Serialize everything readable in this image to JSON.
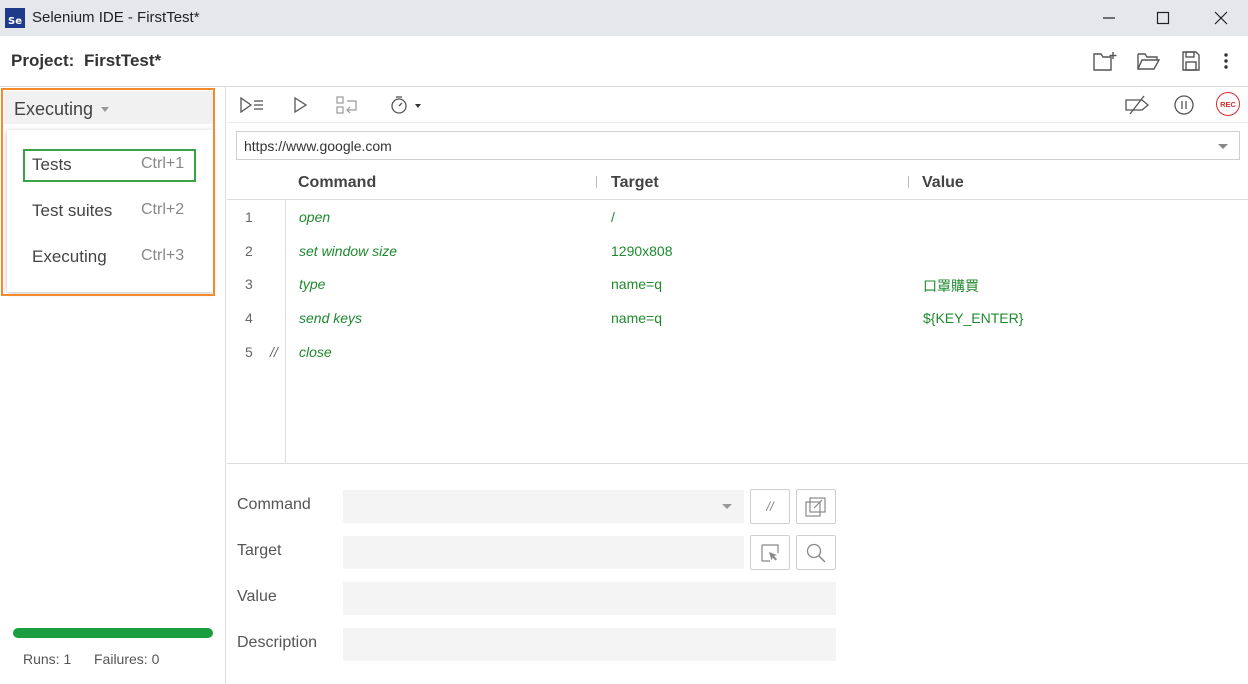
{
  "window": {
    "logo_text": "Se",
    "title": "Selenium IDE - FirstTest*"
  },
  "project": {
    "label": "Project:",
    "name": "FirstTest*"
  },
  "sidebar": {
    "current_view": "Executing",
    "menu": [
      {
        "label": "Tests",
        "shortcut": "Ctrl+1"
      },
      {
        "label": "Test suites",
        "shortcut": "Ctrl+2"
      },
      {
        "label": "Executing",
        "shortcut": "Ctrl+3"
      }
    ],
    "progress": 1.0,
    "runs": "Runs: 1",
    "failures": "Failures: 0"
  },
  "toolbar": {
    "rec_label": "REC"
  },
  "url": {
    "value": "https://www.google.com"
  },
  "table": {
    "headers": {
      "command": "Command",
      "target": "Target",
      "value": "Value"
    },
    "rows": [
      {
        "num": "1",
        "comment": "",
        "command": "open",
        "target": "/",
        "value": ""
      },
      {
        "num": "2",
        "comment": "",
        "command": "set window size",
        "target": "1290x808",
        "value": ""
      },
      {
        "num": "3",
        "comment": "",
        "command": "type",
        "target": "name=q",
        "value": "口罩購買"
      },
      {
        "num": "4",
        "comment": "",
        "command": "send keys",
        "target": "name=q",
        "value": "${KEY_ENTER}"
      },
      {
        "num": "5",
        "comment": "//",
        "command": "close",
        "target": "",
        "value": ""
      }
    ]
  },
  "editor": {
    "command_label": "Command",
    "target_label": "Target",
    "value_label": "Value",
    "description_label": "Description",
    "comment_toggle": "//"
  },
  "colors": {
    "accent_orange": "#f58a2c",
    "accent_green": "#3aa34a",
    "command_green": "#1e8a2e",
    "rec_red": "#d32f2f"
  }
}
